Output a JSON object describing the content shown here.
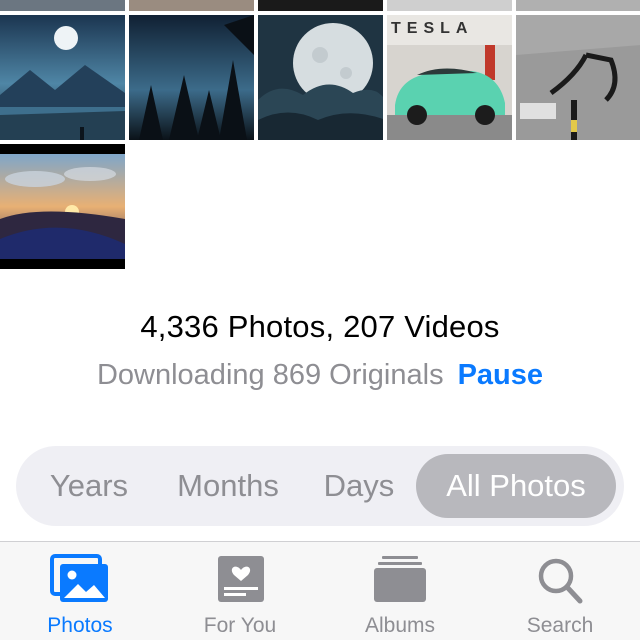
{
  "library": {
    "count_text": "4,336 Photos, 207 Videos",
    "status_text": "Downloading 869 Originals",
    "pause_label": "Pause"
  },
  "view_selector": {
    "segments": [
      "Years",
      "Months",
      "Days",
      "All Photos"
    ],
    "selected": "All Photos"
  },
  "tab_bar": {
    "tabs": [
      {
        "label": "Photos",
        "icon": "photos-icon"
      },
      {
        "label": "For You",
        "icon": "for-you-icon"
      },
      {
        "label": "Albums",
        "icon": "albums-icon"
      },
      {
        "label": "Search",
        "icon": "search-icon"
      }
    ],
    "selected": "Photos"
  },
  "grid": {
    "photos": [
      {
        "subject": "mountain lake under moon"
      },
      {
        "subject": "pine forest at night"
      },
      {
        "subject": "full moon over clouds"
      },
      {
        "subject": "mint green Tesla car",
        "text": "TESLA"
      },
      {
        "subject": "bicycle handlebar on road"
      },
      {
        "subject": "sunset over hills"
      }
    ]
  },
  "colors": {
    "accent": "#0a7aff",
    "secondary_text": "#8e8e93",
    "segment_selected": "#b8b8bd",
    "segment_track": "#efeff4",
    "tabbar_bg": "#f7f7f7"
  }
}
